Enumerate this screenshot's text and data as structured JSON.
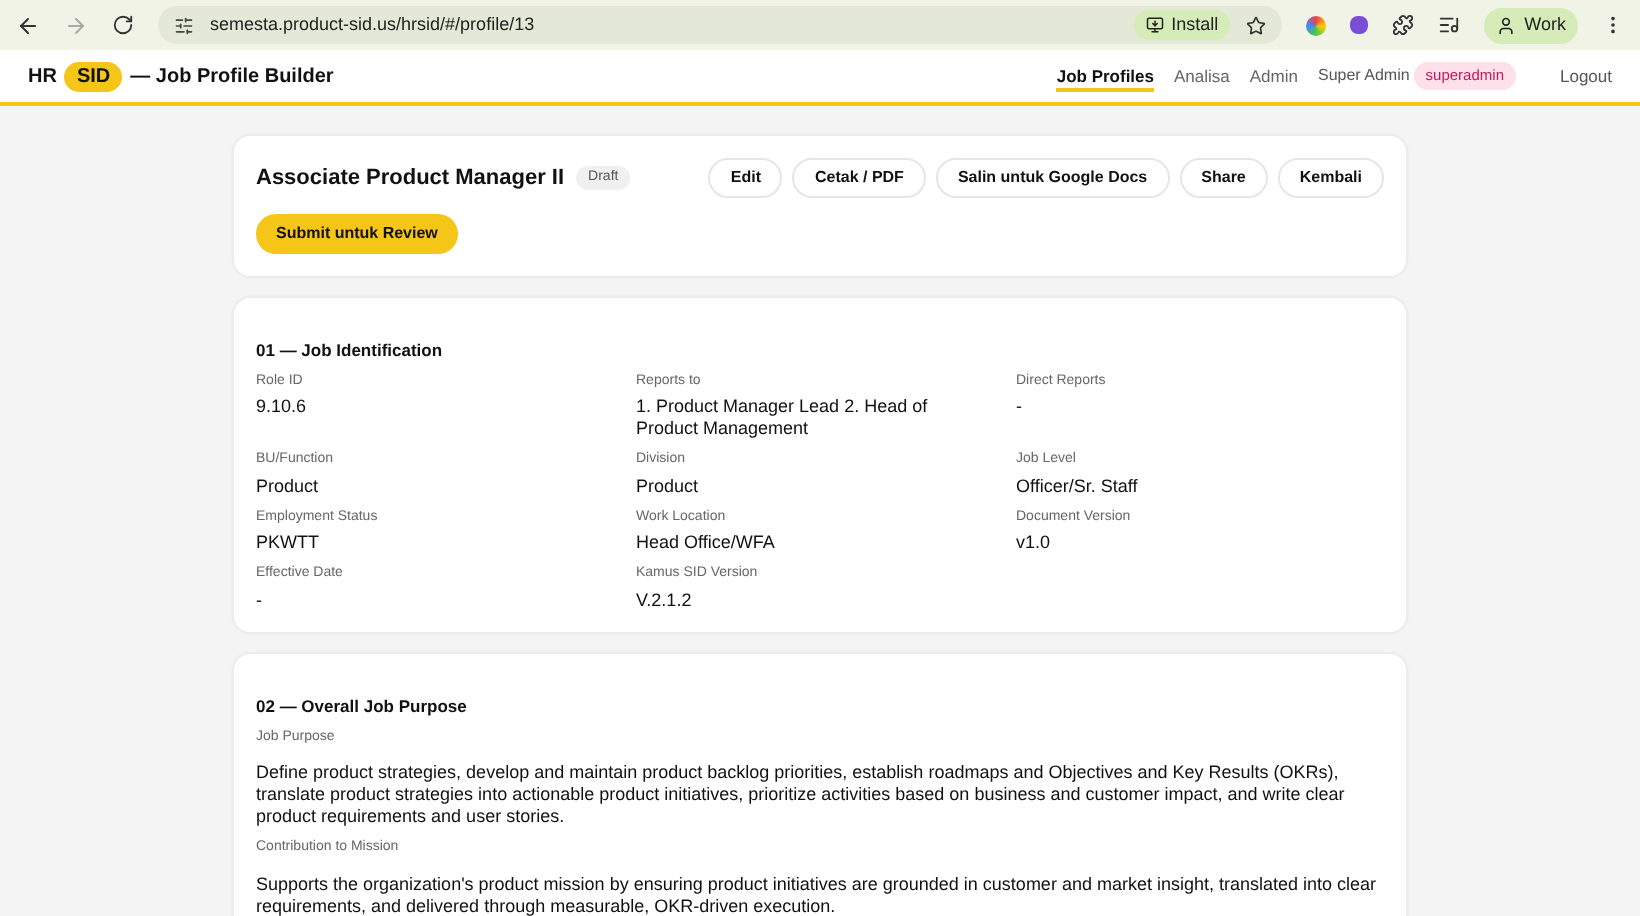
{
  "browser": {
    "url": "semesta.product-sid.us/hrsid/#/profile/13",
    "install_label": "Install",
    "profile_label": "Work"
  },
  "header": {
    "brand_prefix": "HR",
    "brand_badge": "SID",
    "brand_suffix": "— Job Profile Builder",
    "nav": [
      {
        "label": "Job Profiles",
        "selected": true
      },
      {
        "label": "Analisa",
        "selected": false
      },
      {
        "label": "Admin",
        "selected": false
      }
    ],
    "user_name": "Super Admin",
    "role_badge": "superadmin",
    "logout": "Logout"
  },
  "profile": {
    "title": "Associate Product Manager II",
    "status": "Draft",
    "actions": [
      "Edit",
      "Cetak / PDF",
      "Salin untuk Google Docs",
      "Share",
      "Kembali"
    ],
    "submit": "Submit untuk Review"
  },
  "identification": {
    "heading": "01 — Job Identification",
    "fields": [
      {
        "label": "Role ID",
        "value": "9.10.6"
      },
      {
        "label": "Reports to",
        "value": "1. Product Manager Lead 2. Head of Product Management"
      },
      {
        "label": "Direct Reports",
        "value": "-"
      },
      {
        "label": "BU/Function",
        "value": "Product"
      },
      {
        "label": "Division",
        "value": "Product"
      },
      {
        "label": "Job Level",
        "value": "Officer/Sr. Staff"
      },
      {
        "label": "Employment Status",
        "value": "PKWTT"
      },
      {
        "label": "Work Location",
        "value": "Head Office/WFA"
      },
      {
        "label": "Document Version",
        "value": "v1.0"
      },
      {
        "label": "Effective Date",
        "value": "-"
      },
      {
        "label": "Kamus SID Version",
        "value": "V.2.1.2"
      }
    ]
  },
  "purpose": {
    "heading": "02 — Overall Job Purpose",
    "fields": [
      {
        "label": "Job Purpose",
        "value": "Define product strategies, develop and maintain product backlog priorities, establish roadmaps and Objectives and Key Results (OKRs), translate product strategies into actionable product initiatives, prioritize activities based on business and customer impact, and write clear product requirements and user stories."
      },
      {
        "label": "Contribution to Mission",
        "value": "Supports the organization's product mission by ensuring product initiatives are grounded in customer and market insight, translated into clear requirements, and delivered through measurable, OKR-driven execution."
      }
    ]
  }
}
